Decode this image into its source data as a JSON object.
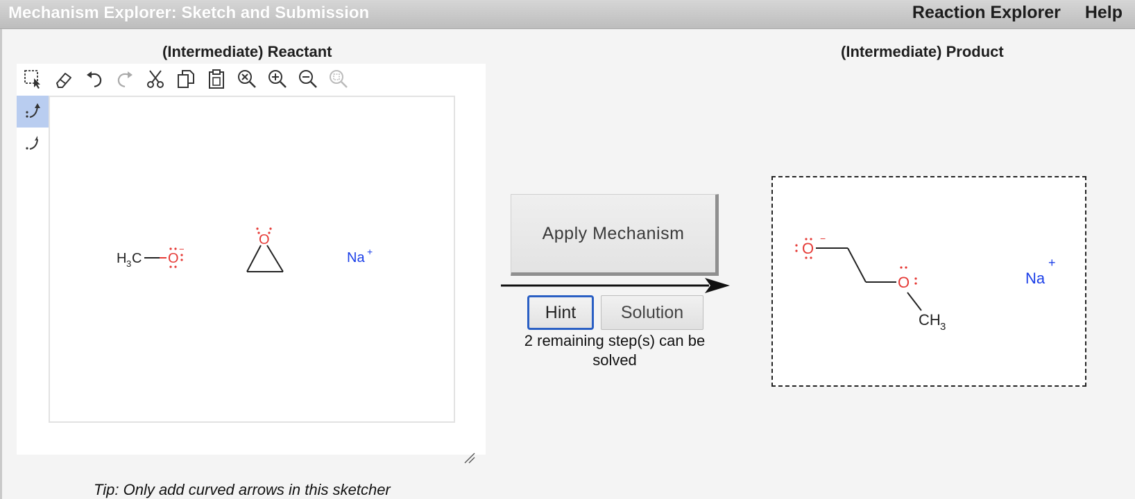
{
  "window": {
    "title": "Mechanism Explorer: Sketch and Submission"
  },
  "nav": {
    "reaction_explorer": "Reaction Explorer",
    "help": "Help"
  },
  "reactant": {
    "heading": "(Intermediate) Reactant",
    "toolbar": [
      "select-icon",
      "eraser-icon",
      "undo-icon",
      "redo-icon",
      "cut-icon",
      "copy-icon",
      "paste-icon",
      "zoom-clear-icon",
      "zoom-in-icon",
      "zoom-out-icon",
      "zoom-fit-icon"
    ],
    "side_tools": [
      "electron-pair-arrow-icon",
      "single-electron-arrow-icon"
    ],
    "molecules": {
      "methoxide": {
        "h": "H",
        "sub": "3",
        "c": "C",
        "o": "O",
        "charge": "−"
      },
      "epoxide": {
        "o": "O"
      },
      "sodium": {
        "na": "Na",
        "charge": "+"
      }
    },
    "tip": "Tip: Only add curved arrows in this sketcher"
  },
  "mechanism": {
    "apply_label": "Apply Mechanism",
    "hint_label": "Hint",
    "solution_label": "Solution",
    "steps_text": "2 remaining step(s) can be solved"
  },
  "product": {
    "heading": "(Intermediate) Product",
    "molecules": {
      "alkoxide": {
        "o1": "O",
        "o1_charge": "−",
        "o2": "O",
        "ch": "CH",
        "sub": "3"
      },
      "sodium": {
        "na": "Na",
        "charge": "+"
      }
    }
  },
  "colors": {
    "oxygen": "#e53935",
    "sodium": "#1a3ee8",
    "bond": "#222222",
    "hint_border": "#2a5fc4",
    "active_tool": "#b9cdf0"
  }
}
